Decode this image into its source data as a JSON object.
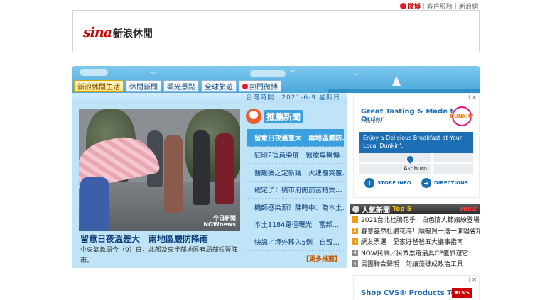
{
  "toplinks": {
    "weibo": "微博",
    "service": "客戶服務",
    "sina": "新浪網"
  },
  "header": {
    "logo_text": "sina",
    "site_name": "新浪休閒"
  },
  "nav": {
    "tabs": [
      {
        "label": "新浪休閒生活",
        "active": true
      },
      {
        "label": "休閒新聞",
        "active": false
      },
      {
        "label": "觀光景點",
        "active": false
      },
      {
        "label": "全球旅遊",
        "active": false
      },
      {
        "label": "熱門微博",
        "active": false
      }
    ]
  },
  "datebar": {
    "text": "台灣時間：2021-6-9 星期日"
  },
  "featured": {
    "watermark": "今日新聞\nNOWnews",
    "title": "留意日夜溫差大　兩地區嚴防降雨",
    "summary": "中央氣象局今（9）日，北部及東半部地區有局部短暫陣雨。"
  },
  "recommended": {
    "title": "推薦新聞",
    "items": [
      "留意日夜溫差大　兩地區嚴防…",
      "駐印2官員染疫　醫療專機傳…",
      "醫護疲乏定新議　火速覆突覆…",
      "確定了！桃市府開罰富特案…",
      "機師感染源？陳時中：為本土…",
      "本土1184路徑曝光　富邦…",
      "快訊／境外移入5例　自毀…"
    ],
    "more": "【更多推薦】"
  },
  "ad1": {
    "title": "Great Tasting & Made to Order",
    "brand": "Dunkin'",
    "logo": "DUNKIN'",
    "box_text": "Enjoy a Delicious Breakfast at Your Local Dunkin'.",
    "map_label": "Ashburn",
    "store_info": "STORE INFO",
    "directions": "DIRECTIONS",
    "adchoices": "i",
    "close": "✕"
  },
  "hot": {
    "title": "人氣新聞",
    "badge": "Top 5",
    "more": "MORE",
    "items": [
      {
        "num": "1",
        "text": "2021台北杜鵑花季　白色情人節繽紛登場"
      },
      {
        "num": "2",
        "text": "春意盎然杜鵑花海！順暢買一送一演唱會精彩"
      },
      {
        "num": "3",
        "text": "網友票選　愛家好爸爸五大議事指南"
      },
      {
        "num": "4",
        "text": "NOW民調／民眾票選最具CP值旅遊它"
      },
      {
        "num": "5",
        "text": "民團聯合聲明　勿讓藻礁成政治工具"
      }
    ]
  },
  "ad2": {
    "title": "Shop CVS® Products Today",
    "logo": "♥CVS"
  }
}
